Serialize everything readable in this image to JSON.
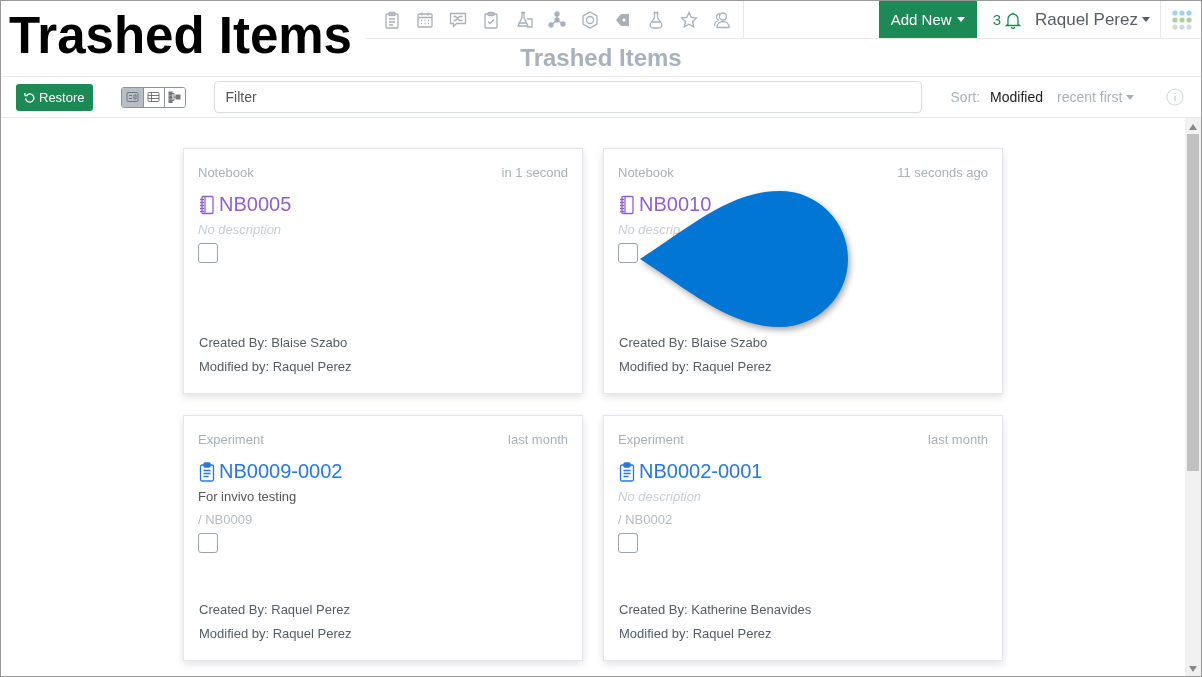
{
  "overlay_title": "Trashed Items",
  "header": {
    "add_new": "Add New",
    "notification_count": "3",
    "user": "Raquel Perez"
  },
  "page_title": "Trashed Items",
  "toolbar": {
    "restore": "Restore",
    "views": [
      {
        "kind": "cards",
        "selected": true
      },
      {
        "kind": "table",
        "selected": false
      },
      {
        "kind": "tree",
        "selected": false
      }
    ],
    "filter": {
      "placeholder": "Filter"
    },
    "sort_label": "Sort:",
    "sort_field": "Modified",
    "sort_order": "recent first"
  },
  "cards": [
    {
      "kind": "notebook",
      "type_label": "Notebook",
      "time": "in 1 second",
      "id": "NB0005",
      "description": "No description",
      "description_missing": true,
      "checked": false,
      "created": "Created By: Blaise Szabo",
      "modified": "Modified by: Raquel Perez"
    },
    {
      "kind": "notebook",
      "type_label": "Notebook",
      "time": "11 seconds ago",
      "id": "NB0010",
      "description": "No descrip",
      "description_missing": true,
      "checked": false,
      "created": "Created By: Blaise Szabo",
      "modified": "Modified by: Raquel Perez",
      "callout": true
    },
    {
      "kind": "experiment",
      "type_label": "Experiment",
      "time": "last month",
      "id": "NB0009-0002",
      "description": "For invivo testing",
      "description_missing": false,
      "parent": "/ NB0009",
      "checked": false,
      "created": "Created By: Raquel Perez",
      "modified": "Modified by: Raquel Perez"
    },
    {
      "kind": "experiment",
      "type_label": "Experiment",
      "time": "last month",
      "id": "NB0002-0001",
      "description": "No description",
      "description_missing": true,
      "parent": "/ NB0002",
      "checked": false,
      "created": "Created By: Katherine Benavides",
      "modified": "Modified by: Raquel Perez"
    }
  ]
}
